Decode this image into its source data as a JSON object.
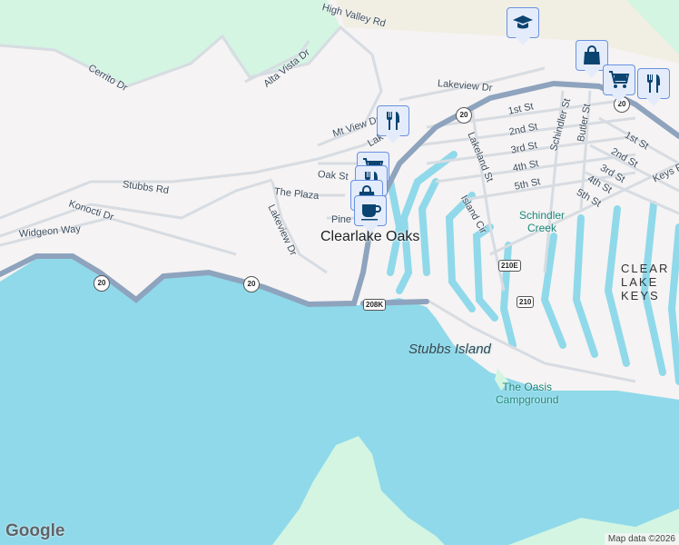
{
  "colors": {
    "land": "#f5f3f3",
    "water": "#8fd9ea",
    "park": "#d3f5e2",
    "highway": "#8ea3bd",
    "road": "#d7dce2",
    "marker_bg": "#e4ecfb",
    "marker_icon": "#0b4470"
  },
  "place_name": "Clearlake Oaks",
  "island": "Stubbs Island",
  "creek": [
    "Schindler",
    "Creek"
  ],
  "campground": [
    "The Oasis",
    "Campground"
  ],
  "area": "CLEAR LAKE KEYS",
  "streets": [
    "High Valley Rd",
    "Cerrito Dr",
    "Alta Vista Dr",
    "Lakeview Dr",
    "Mt View Dr",
    "Lak",
    "Oak St",
    "Stubbs Rd",
    "The Plaza",
    "Konocti Dr",
    "Lakeview Dr",
    "Pine",
    "Widgeon Way",
    "1st St",
    "2nd St",
    "3rd St",
    "4th St",
    "5th St",
    "Lakeland St",
    "Island Cir",
    "Schindler St",
    "Butler St",
    "1st St",
    "2nd St",
    "3rd St",
    "4th St",
    "5th St",
    "Keys Rd"
  ],
  "route_shields": [
    "20",
    "20",
    "20",
    "20"
  ],
  "route_boxes": [
    "210E",
    "210",
    "208K"
  ],
  "markers": [
    {
      "icon": "school-icon"
    },
    {
      "icon": "shopping-bag-icon"
    },
    {
      "icon": "cart-icon"
    },
    {
      "icon": "restaurant-icon"
    },
    {
      "icon": "restaurant-icon"
    },
    {
      "icon": "cart-icon"
    },
    {
      "icon": "restaurant-icon"
    },
    {
      "icon": "shopping-bag-icon"
    },
    {
      "icon": "cafe-icon"
    }
  ],
  "logo": "Google",
  "attribution": "Map data ©2026"
}
